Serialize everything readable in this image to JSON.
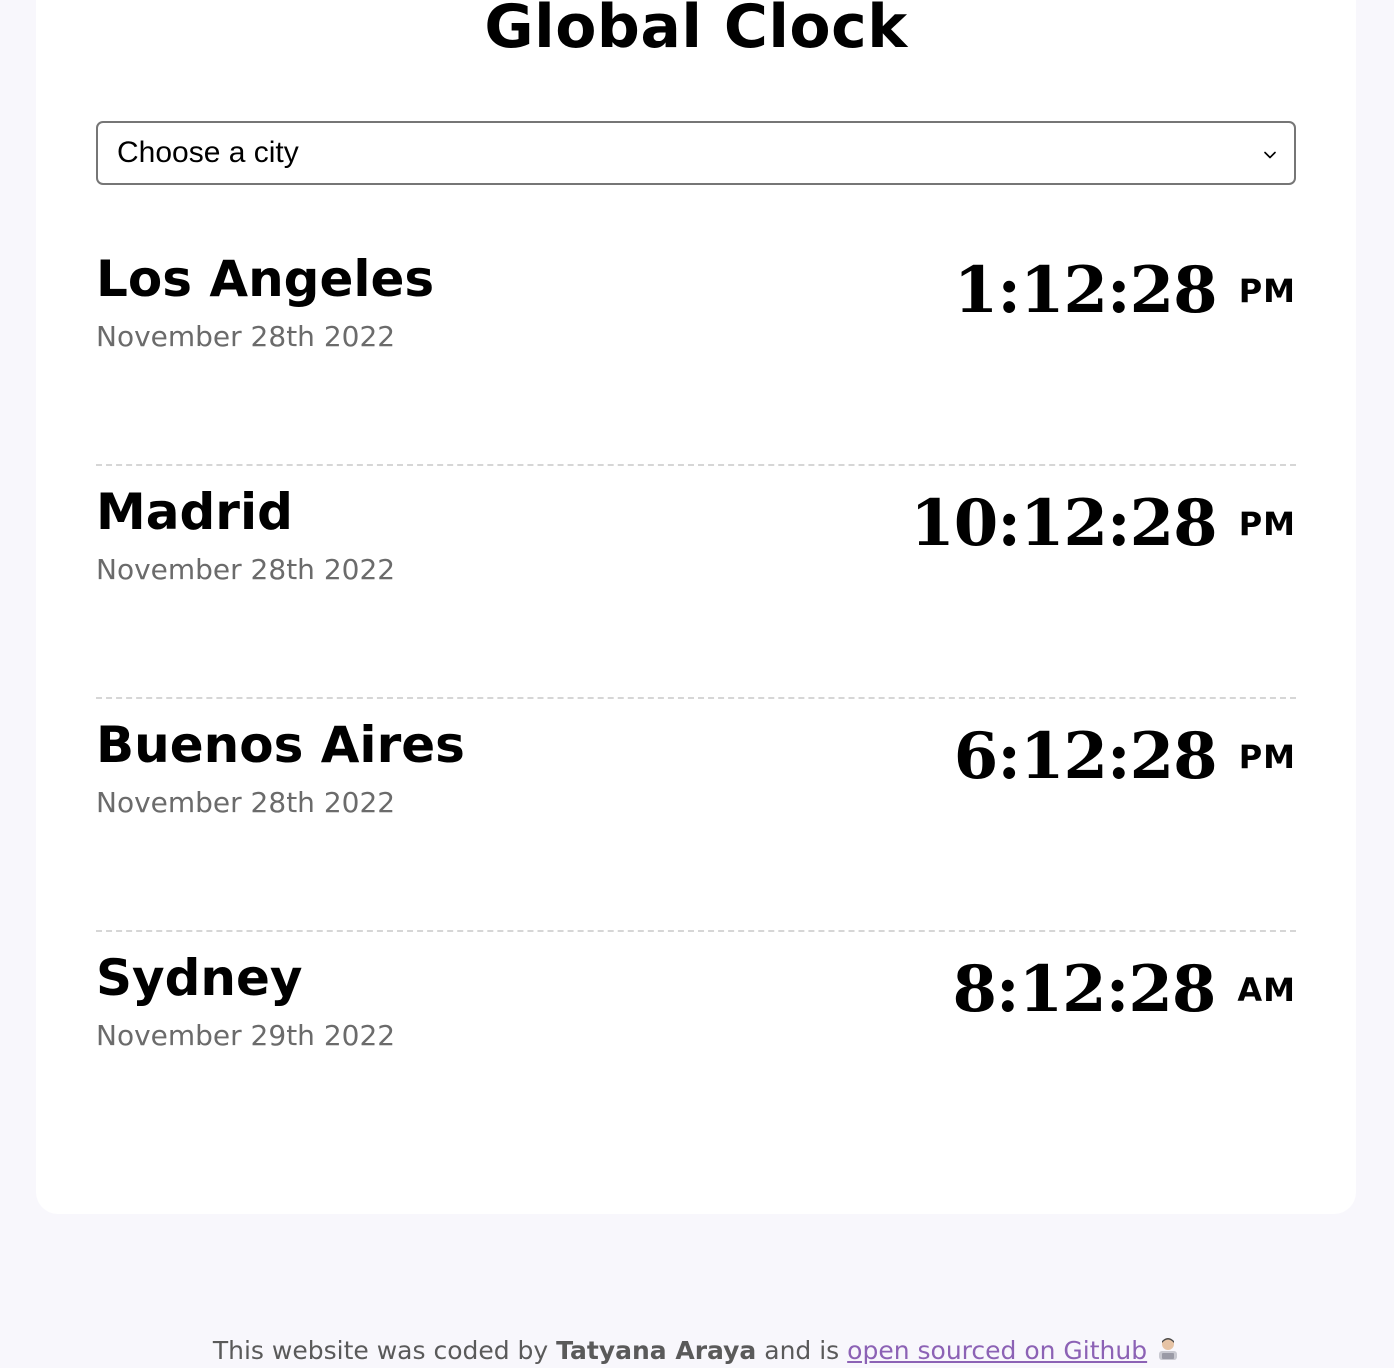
{
  "header": {
    "title": "Global Clock"
  },
  "city_select": {
    "selected": "Choose a city"
  },
  "cities": [
    {
      "name": "Los Angeles",
      "date": "November 28th 2022",
      "time": "1:12:28",
      "period": "PM"
    },
    {
      "name": "Madrid",
      "date": "November 28th 2022",
      "time": "10:12:28",
      "period": "PM"
    },
    {
      "name": "Buenos Aires",
      "date": "November 28th 2022",
      "time": "6:12:28",
      "period": "PM"
    },
    {
      "name": "Sydney",
      "date": "November 29th 2022",
      "time": "8:12:28",
      "period": "AM"
    }
  ],
  "footer": {
    "prefix": "This website was coded by ",
    "author": "Tatyana Araya",
    "middle": " and is ",
    "link_text": "open sourced on Github",
    "emoji_icon": "technologist-icon"
  }
}
